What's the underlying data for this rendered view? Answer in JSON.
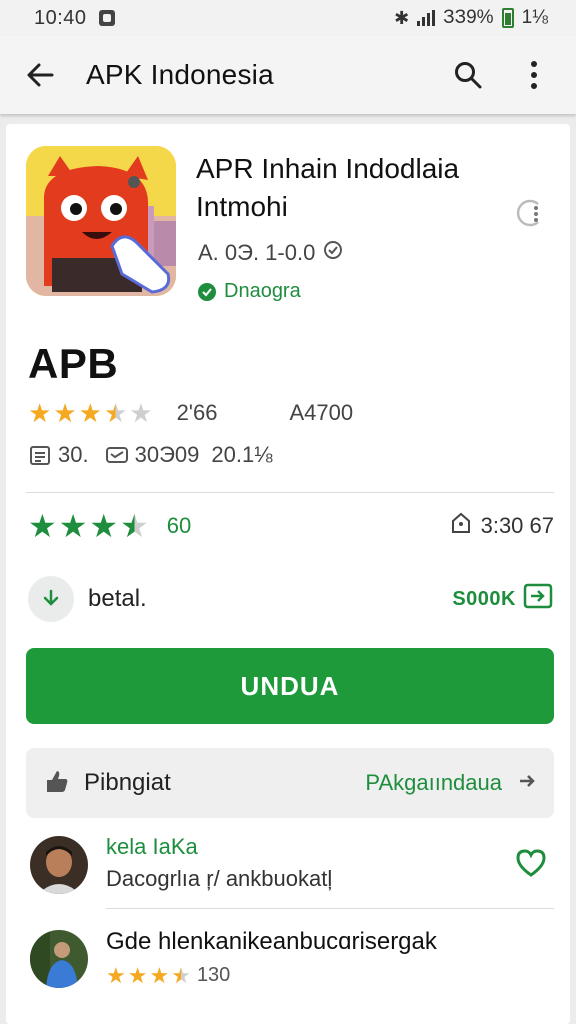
{
  "status_bar": {
    "time": "10:40",
    "battery_text": "ЗЗ9%",
    "extra": "1⅛"
  },
  "app_bar": {
    "title": "APK Indonesia"
  },
  "app": {
    "name": "APR Inhain Indodlaia Intmohi",
    "version": "A. 0Э. 1-0.0",
    "developer": "Dnaogra",
    "heading": "APB",
    "rating_stars": 3.5,
    "rating_count": "2'66",
    "downloads": "A4700",
    "meta_size": "30.",
    "meta_date": "30Э09",
    "meta_percent": "20.1⅛",
    "score_stars": 3.5,
    "score_value": "60",
    "time_value": "3:30 67",
    "detail_label": "betal.",
    "share_label": "S000K"
  },
  "install_button": {
    "label": "UNDUA"
  },
  "reviews_section": {
    "label": "Pibngiat",
    "link": "PAkgaıındaua"
  },
  "reviews": [
    {
      "name": "kela IaKa",
      "text": "Dacogrlıa ŗ/ ankbuokatļ"
    },
    {
      "title": "Gde hlenkanikeanbucɑrisergak",
      "stars": 3.5,
      "count": "130"
    }
  ],
  "colors": {
    "accent_green": "#1e9a3a",
    "star_gold": "#f4a921"
  },
  "icons": [
    "back-arrow-icon",
    "search-icon",
    "more-vert-icon",
    "info-icon",
    "clock-icon",
    "verified-icon",
    "download-icon",
    "share-icon",
    "thumb-icon",
    "chevron-right-icon",
    "heart-icon"
  ]
}
